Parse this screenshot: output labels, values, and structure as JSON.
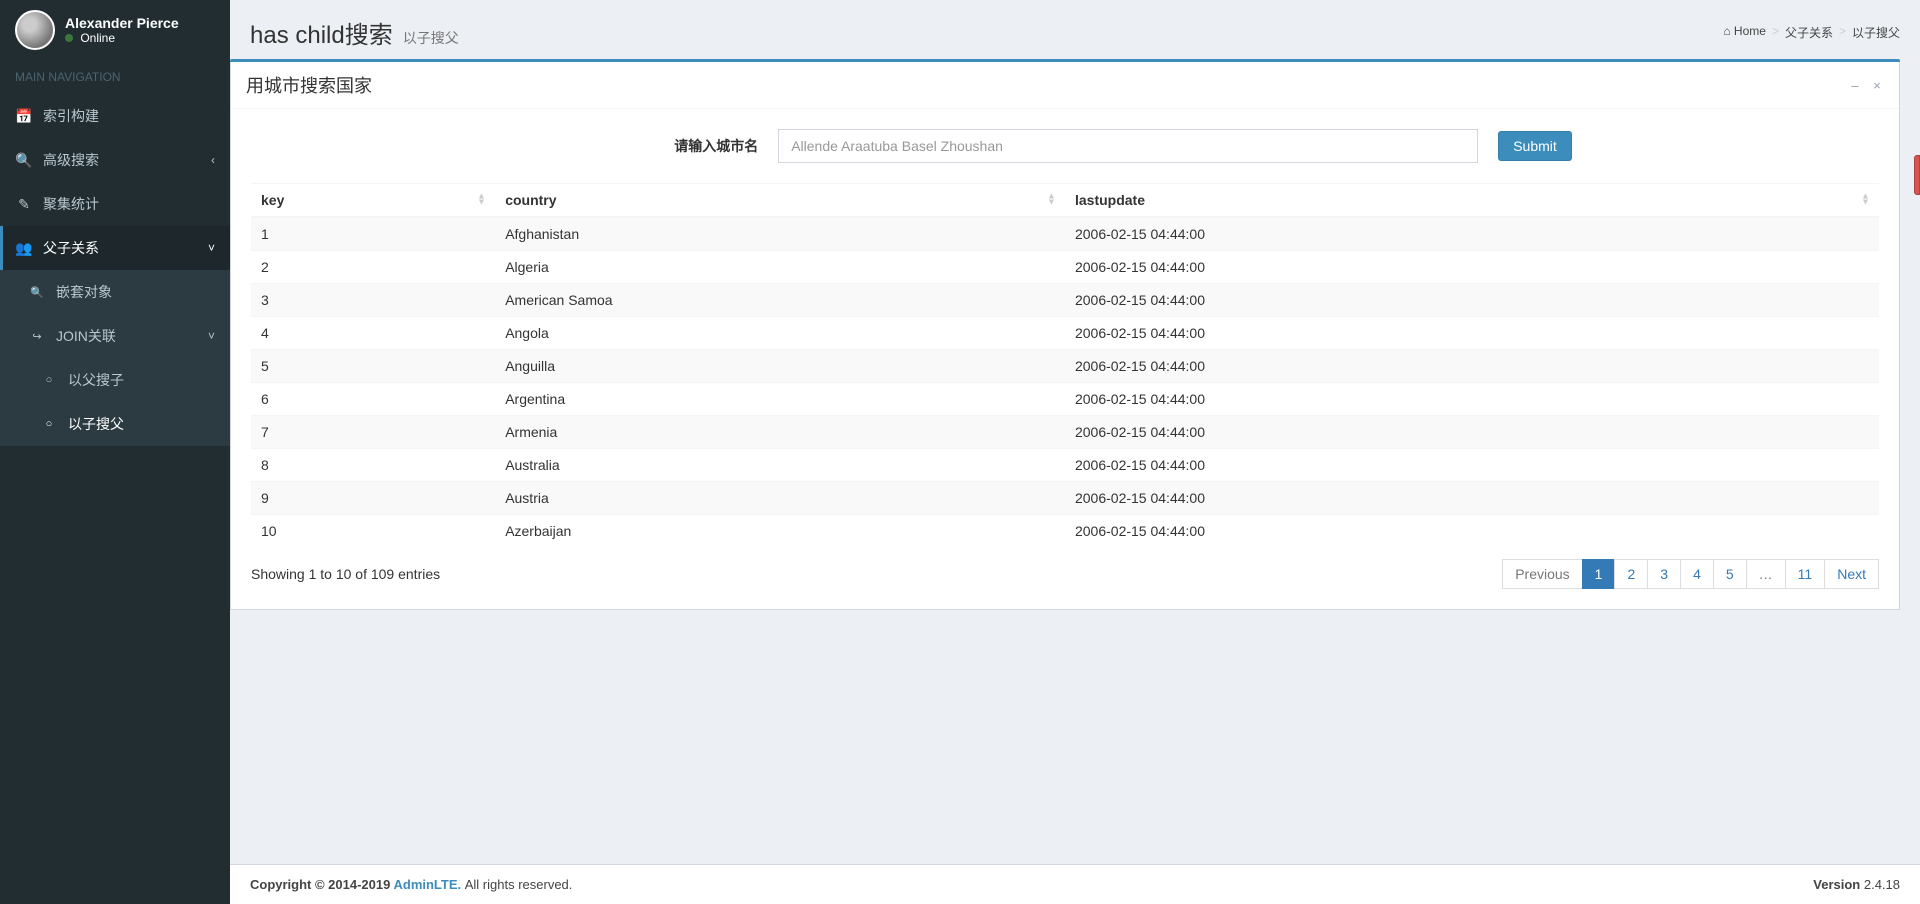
{
  "user": {
    "name": "Alexander Pierce",
    "status": "Online"
  },
  "sidebar": {
    "header": "MAIN NAVIGATION",
    "items": [
      {
        "icon": "calendar-icon",
        "glyph": "📅",
        "label": "索引构建"
      },
      {
        "icon": "search-icon",
        "glyph": "🔍",
        "label": "高级搜索",
        "caret": "‹"
      },
      {
        "icon": "edit-icon",
        "glyph": "✎",
        "label": "聚集统计"
      },
      {
        "icon": "users-icon",
        "glyph": "👥",
        "label": "父子关系",
        "caret": "˅",
        "active": true
      }
    ],
    "subitems": [
      {
        "icon": "search-icon",
        "glyph": "🔍",
        "label": "嵌套对象"
      },
      {
        "icon": "link-icon",
        "glyph": "↪",
        "label": "JOIN关联",
        "caret": "˅"
      }
    ],
    "subsub": [
      {
        "glyph": "○",
        "label": "以父搜子"
      },
      {
        "glyph": "○",
        "label": "以子搜父",
        "current": true
      }
    ]
  },
  "header": {
    "title": "has child搜索",
    "subtitle": "以子搜父"
  },
  "breadcrumb": {
    "home_glyph": "⌂",
    "home": "Home",
    "mid": "父子关系",
    "leaf": "以子搜父"
  },
  "box": {
    "title": "用城市搜索国家",
    "minimize": "–",
    "close": "×"
  },
  "form": {
    "label": "请输入城市名",
    "placeholder": "Allende Araatuba Basel Zhoushan",
    "submit": "Submit"
  },
  "table": {
    "columns": [
      "key",
      "country",
      "lastupdate"
    ],
    "rows": [
      {
        "key": "1",
        "country": "Afghanistan",
        "lastupdate": "2006-02-15 04:44:00"
      },
      {
        "key": "2",
        "country": "Algeria",
        "lastupdate": "2006-02-15 04:44:00"
      },
      {
        "key": "3",
        "country": "American Samoa",
        "lastupdate": "2006-02-15 04:44:00"
      },
      {
        "key": "4",
        "country": "Angola",
        "lastupdate": "2006-02-15 04:44:00"
      },
      {
        "key": "5",
        "country": "Anguilla",
        "lastupdate": "2006-02-15 04:44:00"
      },
      {
        "key": "6",
        "country": "Argentina",
        "lastupdate": "2006-02-15 04:44:00"
      },
      {
        "key": "7",
        "country": "Armenia",
        "lastupdate": "2006-02-15 04:44:00"
      },
      {
        "key": "8",
        "country": "Australia",
        "lastupdate": "2006-02-15 04:44:00"
      },
      {
        "key": "9",
        "country": "Austria",
        "lastupdate": "2006-02-15 04:44:00"
      },
      {
        "key": "10",
        "country": "Azerbaijan",
        "lastupdate": "2006-02-15 04:44:00"
      }
    ],
    "info": "Showing 1 to 10 of 109 entries"
  },
  "pagination": {
    "prev": "Previous",
    "pages": [
      "1",
      "2",
      "3",
      "4",
      "5",
      "…",
      "11"
    ],
    "next": "Next",
    "active": "1"
  },
  "footer": {
    "copyright_prefix": "Copyright © 2014-2019 ",
    "brand": "AdminLTE.",
    "copyright_suffix": " All rights reserved.",
    "version_label": "Version",
    "version": " 2.4.18"
  }
}
